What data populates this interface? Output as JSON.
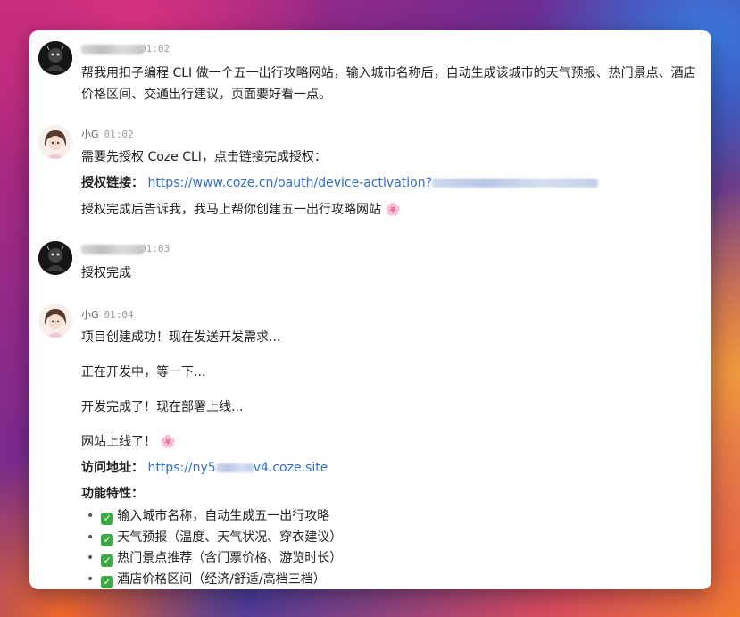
{
  "messages": [
    {
      "sender": "user",
      "time": "01:02",
      "text": "帮我用扣子编程 CLI 做一个五一出行攻略网站，输入城市名称后，自动生成该城市的天气预报、热门景点、酒店价格区间、交通出行建议，页面要好看一点。"
    },
    {
      "sender": "小G",
      "time": "01:02",
      "line1": "需要先授权 Coze CLI，点击链接完成授权：",
      "auth_label": "授权链接：",
      "auth_link": "https://www.coze.cn/oauth/device-activation?",
      "line3": "授权完成后告诉我，我马上帮你创建五一出行攻略网站",
      "flower": "🌸"
    },
    {
      "sender": "user",
      "time": "01:03",
      "text": "授权完成"
    },
    {
      "sender": "小G",
      "time": "01:04",
      "lines": [
        "项目创建成功！现在发送开发需求...",
        "正在开发中，等一下...",
        "开发完成了！现在部署上线..."
      ],
      "online": "网站上线了！",
      "flower": "🌸",
      "visit_label": "访问地址：",
      "visit_prefix": "https://ny5",
      "visit_suffix": "v4.coze.site",
      "features_title": "功能特性：",
      "features": [
        "输入城市名称，自动生成五一出行攻略",
        "天气预报（温度、天气状况、穿衣建议）",
        "热门景点推荐（含门票价格、游览时长）",
        "酒店价格区间（经济/舒适/高档三档）"
      ]
    }
  ],
  "colors": {
    "link": "#2f6fd1",
    "check": "#3aa844"
  }
}
